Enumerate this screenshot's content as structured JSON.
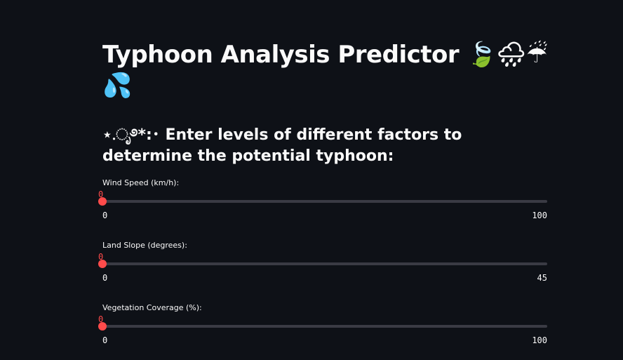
{
  "header": {
    "title": "Typhoon Analysis Predictor 🍃🌧☔💦",
    "subtitle": "⋆.ೃ࿔*:･ Enter levels of different factors to determine the potential typhoon:"
  },
  "sliders": [
    {
      "label": "Wind Speed (km/h):",
      "value": 0,
      "min": 0,
      "max": 100
    },
    {
      "label": "Land Slope (degrees):",
      "value": 0,
      "min": 0,
      "max": 45
    },
    {
      "label": "Vegetation Coverage (%):",
      "value": 0,
      "min": 0,
      "max": 100
    }
  ],
  "colors": {
    "background": "#0e1117",
    "accent": "#ff4b4b",
    "track": "#3a3b44",
    "text": "#fafafa"
  }
}
